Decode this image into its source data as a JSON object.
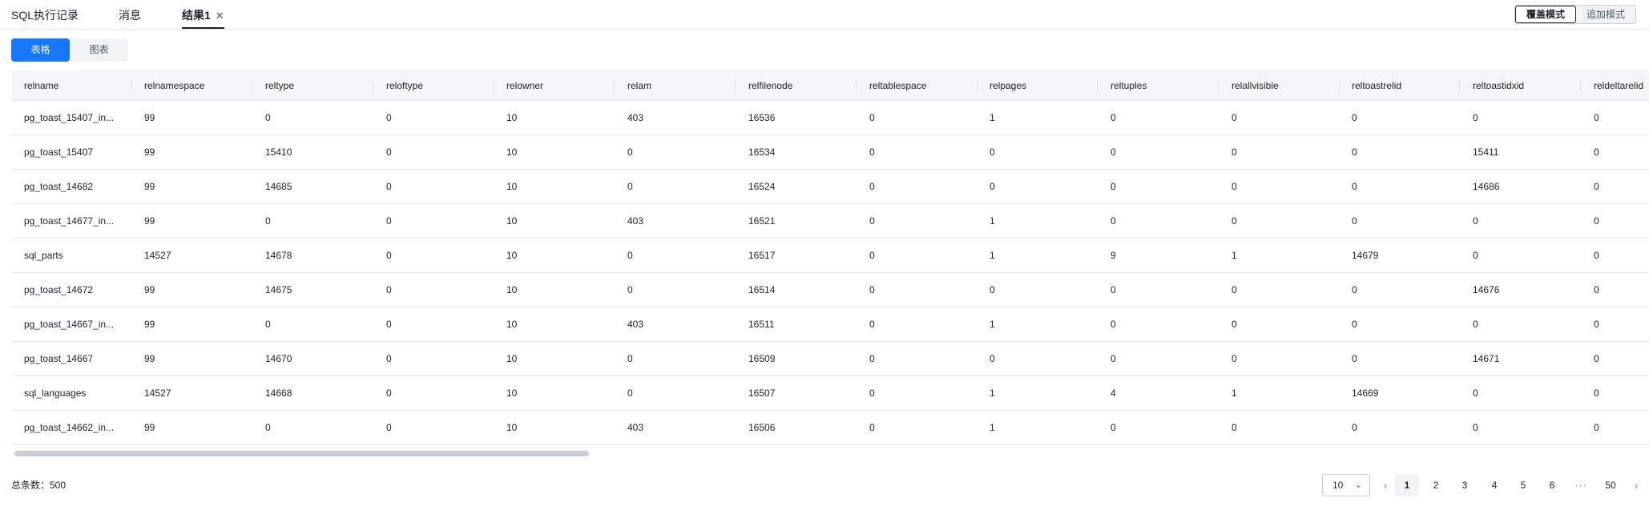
{
  "tabs": [
    {
      "label": "SQL执行记录"
    },
    {
      "label": "消息"
    },
    {
      "label": "结果1",
      "close": "✕"
    }
  ],
  "modes": {
    "overwrite": "覆盖模式",
    "append": "追加模式"
  },
  "view": {
    "table": "表格",
    "chart": "图表"
  },
  "columns": [
    "relname",
    "relnamespace",
    "reltype",
    "reloftype",
    "relowner",
    "relam",
    "relfilenode",
    "reltablespace",
    "relpages",
    "reltuples",
    "relallvisible",
    "reltoastrelid",
    "reltoastidxid",
    "reldeltarelid"
  ],
  "rows": [
    [
      "pg_toast_15407_in...",
      "99",
      "0",
      "0",
      "10",
      "403",
      "16536",
      "0",
      "1",
      "0",
      "0",
      "0",
      "0",
      "0"
    ],
    [
      "pg_toast_15407",
      "99",
      "15410",
      "0",
      "10",
      "0",
      "16534",
      "0",
      "0",
      "0",
      "0",
      "0",
      "15411",
      "0"
    ],
    [
      "pg_toast_14682",
      "99",
      "14685",
      "0",
      "10",
      "0",
      "16524",
      "0",
      "0",
      "0",
      "0",
      "0",
      "14686",
      "0"
    ],
    [
      "pg_toast_14677_in...",
      "99",
      "0",
      "0",
      "10",
      "403",
      "16521",
      "0",
      "1",
      "0",
      "0",
      "0",
      "0",
      "0"
    ],
    [
      "sql_parts",
      "14527",
      "14678",
      "0",
      "10",
      "0",
      "16517",
      "0",
      "1",
      "9",
      "1",
      "14679",
      "0",
      "0"
    ],
    [
      "pg_toast_14672",
      "99",
      "14675",
      "0",
      "10",
      "0",
      "16514",
      "0",
      "0",
      "0",
      "0",
      "0",
      "14676",
      "0"
    ],
    [
      "pg_toast_14667_in...",
      "99",
      "0",
      "0",
      "10",
      "403",
      "16511",
      "0",
      "1",
      "0",
      "0",
      "0",
      "0",
      "0"
    ],
    [
      "pg_toast_14667",
      "99",
      "14670",
      "0",
      "10",
      "0",
      "16509",
      "0",
      "0",
      "0",
      "0",
      "0",
      "14671",
      "0"
    ],
    [
      "sql_languages",
      "14527",
      "14668",
      "0",
      "10",
      "0",
      "16507",
      "0",
      "1",
      "4",
      "1",
      "14669",
      "0",
      "0"
    ],
    [
      "pg_toast_14662_in...",
      "99",
      "0",
      "0",
      "10",
      "403",
      "16506",
      "0",
      "1",
      "0",
      "0",
      "0",
      "0",
      "0"
    ]
  ],
  "footer": {
    "total": "总条数：500",
    "page_size": "10",
    "pages": [
      "1",
      "2",
      "3",
      "4",
      "5",
      "6",
      "···",
      "50"
    ],
    "prev": "‹",
    "next": "›"
  }
}
